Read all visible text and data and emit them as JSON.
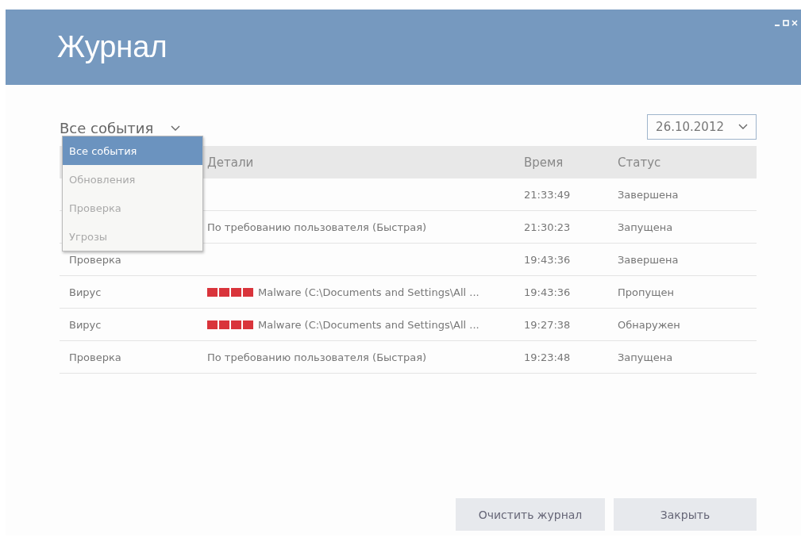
{
  "window": {
    "title": "Журнал"
  },
  "filter": {
    "value": "Все события",
    "options": [
      {
        "label": "Все события",
        "selected": true
      },
      {
        "label": "Обновления",
        "selected": false
      },
      {
        "label": "Проверка",
        "selected": false
      },
      {
        "label": "Угрозы",
        "selected": false
      }
    ]
  },
  "date": {
    "value": "26.10.2012"
  },
  "table": {
    "columns": [
      "Детали",
      "Время",
      "Статус"
    ],
    "rows": [
      {
        "details": "",
        "threat": false,
        "time": "21:33:49",
        "status": "Завершена"
      },
      {
        "details": "По требованию пользователя (Быстрая)",
        "threat": false,
        "time": "21:30:23",
        "status": "Запущена"
      },
      {
        "type": "Проверка",
        "details": "",
        "threat": false,
        "time": "19:43:36",
        "status": "Завершена"
      },
      {
        "type": "Вирус",
        "details": "Malware (C:\\Documents and Settings\\All ...",
        "threat": true,
        "time": "19:43:36",
        "status": "Пропущен"
      },
      {
        "type": "Вирус",
        "details": "Malware (C:\\Documents and Settings\\All ...",
        "threat": true,
        "time": "19:27:38",
        "status": "Обнаружен"
      },
      {
        "type": "Проверка",
        "details": "По требованию пользователя (Быстрая)",
        "threat": false,
        "time": "19:23:48",
        "status": "Запущена"
      }
    ]
  },
  "buttons": [
    "Очистить журнал",
    "Закрыть"
  ]
}
